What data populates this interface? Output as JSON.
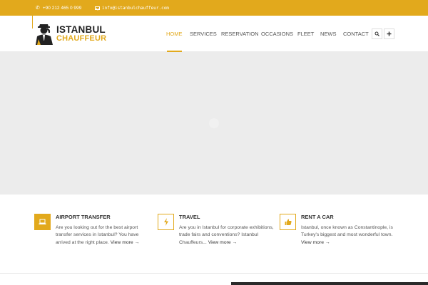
{
  "topbar": {
    "phone": "+90 212 465 0 999",
    "email": "info@istanbulchauffeur.com"
  },
  "logo": {
    "line1": "ISTANBUL",
    "line2": "CHAUFFEUR"
  },
  "nav": {
    "items": [
      {
        "label": "HOME",
        "active": true
      },
      {
        "label": "SERVICES",
        "active": false
      },
      {
        "label": "RESERVATION",
        "active": false
      },
      {
        "label": "OCCASIONS",
        "active": false
      },
      {
        "label": "FLEET",
        "active": false
      },
      {
        "label": "NEWS",
        "active": false
      },
      {
        "label": "CONTACT",
        "active": false
      }
    ],
    "search_icon": "search-icon",
    "plus_icon": "plus-icon"
  },
  "features": [
    {
      "title": "AIRPORT TRANSFER",
      "desc": "Are you looking out for the best airport transfer services in Istanbul? You have arrived at the right place.",
      "more": "View more →",
      "icon": "laptop-icon"
    },
    {
      "title": "TRAVEL",
      "desc": "Are you in Istanbul for corporate exhibitions, trade fairs and conventions? Istanbul Chauffeurs...",
      "more": "View more →",
      "icon": "lightning-icon"
    },
    {
      "title": "RENT A CAR",
      "desc": "Istanbul, once known as Constantinople, is Turkey's biggest and most wonderful town.",
      "more": "View more →",
      "icon": "thumbs-up-icon"
    }
  ],
  "colors": {
    "accent": "#e2a91c",
    "slider_bg": "#ececec",
    "text": "#555555",
    "dark": "#222222"
  }
}
